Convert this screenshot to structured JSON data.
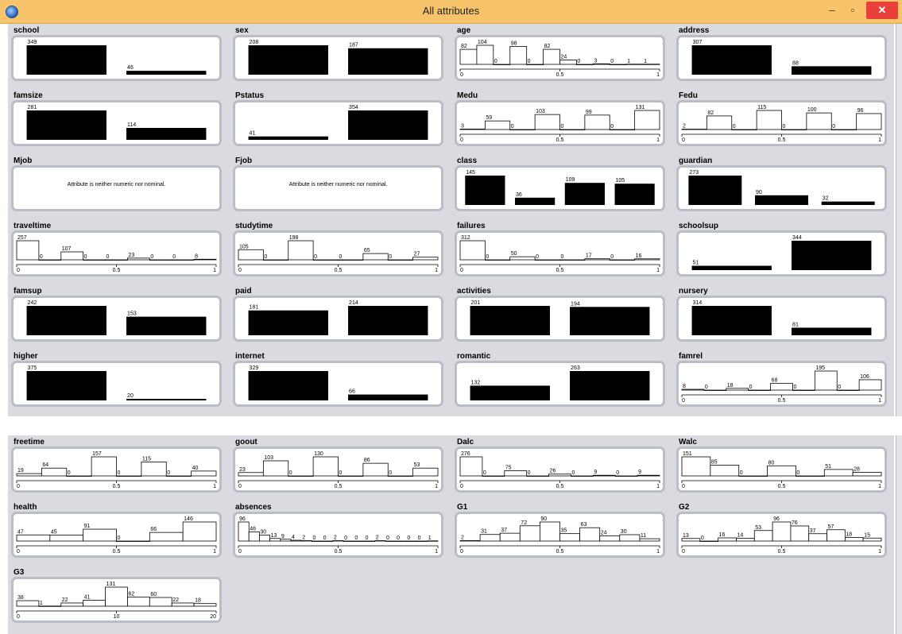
{
  "window": {
    "title": "All attributes",
    "minimize_label": "–",
    "maximize_label": "▫",
    "close_label": "✕",
    "icon": "weka-bird-icon"
  },
  "colors": {
    "titlebar": "#f7c46b",
    "close": "#e8413b",
    "panel": "#d9dbe1",
    "frame": "#b9bdc5",
    "bar": "#000000"
  },
  "sections": [
    {
      "name": "top",
      "attributes": [
        {
          "name": "school",
          "type": "nominal",
          "values": [
            349,
            46
          ]
        },
        {
          "name": "sex",
          "type": "nominal",
          "values": [
            208,
            187
          ]
        },
        {
          "name": "age",
          "type": "numeric",
          "values": [
            82,
            104,
            0,
            98,
            0,
            82,
            24,
            0,
            3,
            0,
            1,
            1
          ],
          "xticks": [
            "0",
            "0.5",
            "1"
          ]
        },
        {
          "name": "address",
          "type": "nominal",
          "values": [
            307,
            88
          ]
        },
        {
          "name": "famsize",
          "type": "nominal",
          "values": [
            281,
            114
          ]
        },
        {
          "name": "Pstatus",
          "type": "nominal",
          "values": [
            41,
            354
          ]
        },
        {
          "name": "Medu",
          "type": "numeric",
          "values": [
            3,
            59,
            0,
            103,
            0,
            99,
            0,
            131
          ],
          "xticks": [
            "0",
            "0.5",
            "1"
          ]
        },
        {
          "name": "Fedu",
          "type": "numeric",
          "values": [
            2,
            82,
            0,
            115,
            0,
            100,
            0,
            96
          ],
          "xticks": [
            "0",
            "0.5",
            "1"
          ]
        },
        {
          "name": "Mjob",
          "type": "message",
          "message": "Attribute is neither numeric nor nominal."
        },
        {
          "name": "Fjob",
          "type": "message",
          "message": "Attribute is neither numeric nor nominal."
        },
        {
          "name": "class",
          "type": "nominal",
          "values": [
            145,
            36,
            109,
            105
          ]
        },
        {
          "name": "guardian",
          "type": "nominal",
          "values": [
            273,
            90,
            32
          ]
        },
        {
          "name": "traveltime",
          "type": "numeric",
          "values": [
            257,
            0,
            107,
            0,
            0,
            23,
            0,
            0,
            8
          ],
          "xticks": [
            "0",
            "0.5",
            "1"
          ]
        },
        {
          "name": "studytime",
          "type": "numeric",
          "values": [
            105,
            0,
            198,
            0,
            0,
            65,
            0,
            27
          ],
          "xticks": [
            "0",
            "0.5",
            "1"
          ]
        },
        {
          "name": "failures",
          "type": "numeric",
          "values": [
            312,
            0,
            50,
            0,
            0,
            17,
            0,
            16
          ],
          "xticks": [
            "0",
            "0.5",
            "1"
          ]
        },
        {
          "name": "schoolsup",
          "type": "nominal",
          "values": [
            51,
            344
          ]
        },
        {
          "name": "famsup",
          "type": "nominal",
          "values": [
            242,
            153
          ]
        },
        {
          "name": "paid",
          "type": "nominal",
          "values": [
            181,
            214
          ]
        },
        {
          "name": "activities",
          "type": "nominal",
          "values": [
            201,
            194
          ]
        },
        {
          "name": "nursery",
          "type": "nominal",
          "values": [
            314,
            81
          ]
        },
        {
          "name": "higher",
          "type": "nominal",
          "values": [
            375,
            20
          ]
        },
        {
          "name": "internet",
          "type": "nominal",
          "values": [
            329,
            66
          ]
        },
        {
          "name": "romantic",
          "type": "nominal",
          "values": [
            132,
            263
          ]
        },
        {
          "name": "famrel",
          "type": "numeric",
          "values": [
            8,
            0,
            18,
            0,
            68,
            0,
            195,
            0,
            106
          ],
          "xticks": [
            "0",
            "0.5",
            "1"
          ]
        }
      ]
    },
    {
      "name": "bottom",
      "attributes": [
        {
          "name": "freetime",
          "type": "numeric",
          "values": [
            19,
            64,
            0,
            157,
            0,
            115,
            0,
            40
          ],
          "xticks": [
            "0",
            "0.5",
            "1"
          ]
        },
        {
          "name": "goout",
          "type": "numeric",
          "values": [
            23,
            103,
            0,
            130,
            0,
            86,
            0,
            53
          ],
          "xticks": [
            "0",
            "0.5",
            "1"
          ]
        },
        {
          "name": "Dalc",
          "type": "numeric",
          "values": [
            276,
            0,
            75,
            0,
            26,
            0,
            9,
            0,
            9
          ],
          "xticks": [
            "0",
            "0.5",
            "1"
          ]
        },
        {
          "name": "Walc",
          "type": "numeric",
          "values": [
            151,
            85,
            0,
            80,
            0,
            51,
            28
          ],
          "xticks": [
            "0",
            "0.5",
            "1"
          ]
        },
        {
          "name": "health",
          "type": "numeric",
          "values": [
            47,
            45,
            91,
            0,
            66,
            146
          ],
          "xticks": [
            "0",
            "0.5",
            "1"
          ]
        },
        {
          "name": "absences",
          "type": "numeric",
          "values": [
            96,
            46,
            30,
            13,
            9,
            4,
            2,
            0,
            0,
            2,
            0,
            0,
            0,
            2,
            0,
            0,
            0,
            0,
            1
          ],
          "xticks": [
            "0",
            "0.5",
            "1"
          ]
        },
        {
          "name": "G1",
          "type": "numeric",
          "values": [
            2,
            31,
            37,
            72,
            90,
            35,
            63,
            24,
            30,
            11
          ],
          "xticks": [
            "0",
            "0.5",
            "1"
          ]
        },
        {
          "name": "G2",
          "type": "numeric",
          "values": [
            13,
            0,
            16,
            14,
            53,
            96,
            76,
            37,
            57,
            18,
            15
          ],
          "xticks": [
            "0",
            "0.5",
            "1"
          ]
        },
        {
          "name": "G3",
          "type": "numeric",
          "values": [
            38,
            1,
            22,
            41,
            131,
            62,
            60,
            22,
            18
          ],
          "xticks": [
            "0",
            "10",
            "20"
          ]
        }
      ]
    }
  ]
}
